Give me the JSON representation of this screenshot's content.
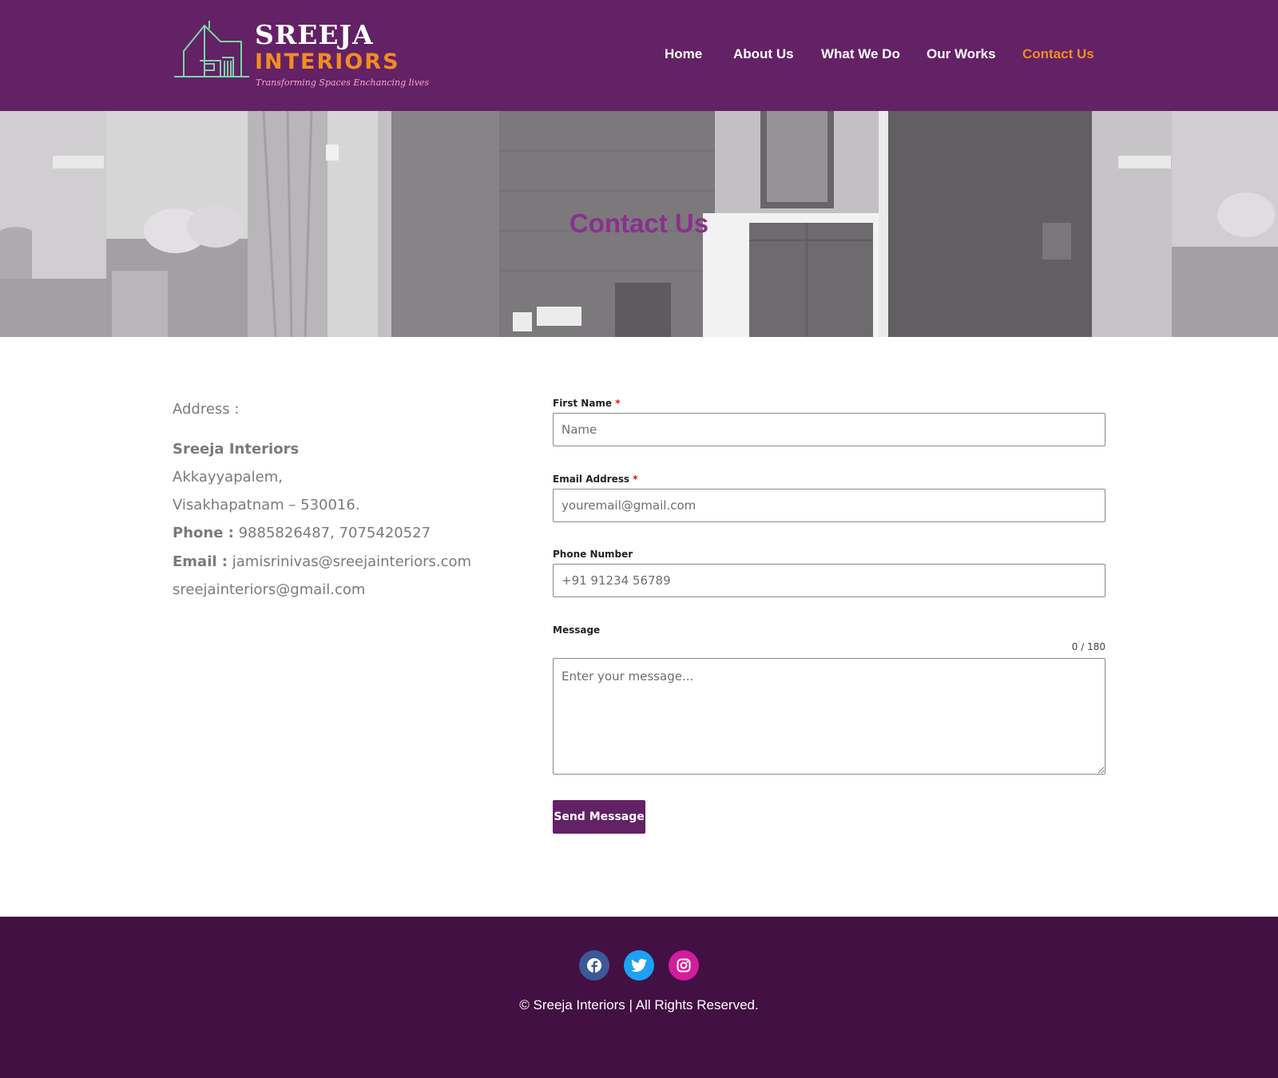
{
  "brand": {
    "name_line1": "SREEJA",
    "name_line2": "INTERIORS",
    "tagline": "Transforming Spaces Enchancing lives",
    "colors": {
      "primary": "#632166",
      "accent": "#f28c24",
      "footer": "#421042"
    }
  },
  "nav": {
    "items": [
      {
        "label": "Home",
        "active": false
      },
      {
        "label": "About Us",
        "active": false
      },
      {
        "label": "What We Do",
        "active": false
      },
      {
        "label": "Our Works",
        "active": false
      },
      {
        "label": "Contact Us",
        "active": true
      }
    ]
  },
  "hero": {
    "title": "Contact Us"
  },
  "contact_info": {
    "address_label": "Address :",
    "company": "Sreeja Interiors",
    "address_line1": "Akkayyapalem,",
    "address_line2": "Visakhapatnam – 530016.",
    "phone_label": "Phone :",
    "phone_value": "9885826487, 7075420527",
    "email_label": "Email :",
    "email_value": "jamisrinivas@sreejainteriors.com",
    "email_value2": "sreejainteriors@gmail.com"
  },
  "form": {
    "first_name": {
      "label": "First Name",
      "required_mark": "*",
      "placeholder": "Name",
      "value": ""
    },
    "email": {
      "label": "Email Address",
      "required_mark": "*",
      "placeholder": "youremail@gmail.com",
      "value": ""
    },
    "phone": {
      "label": "Phone Number",
      "placeholder": "+91 91234 56789",
      "value": ""
    },
    "message": {
      "label": "Message",
      "counter": "0 / 180",
      "placeholder": "Enter your message...",
      "value": ""
    },
    "submit_label": "Send Message"
  },
  "footer": {
    "social_icons": [
      {
        "name": "facebook-icon",
        "color": "#3b5998"
      },
      {
        "name": "twitter-icon",
        "color": "#1da1f2"
      },
      {
        "name": "instagram-icon",
        "color": "#d21d9c"
      }
    ],
    "copyright": "© Sreeja Interiors | All Rights Reserved."
  }
}
